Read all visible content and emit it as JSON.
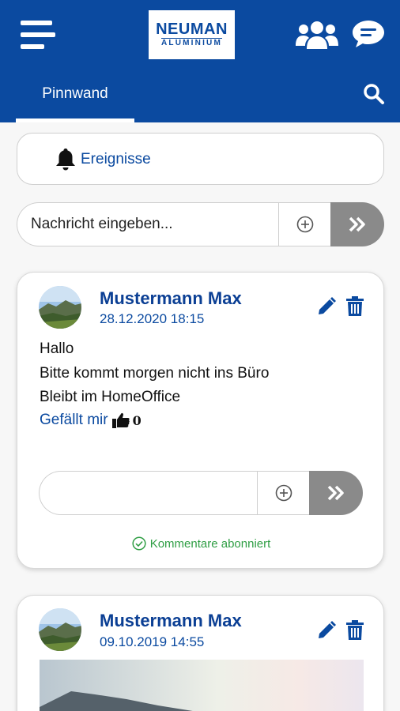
{
  "header": {
    "logo_main": "NEUMAN",
    "logo_sub": "ALUMINIUM",
    "tab_label": "Pinnwand"
  },
  "events": {
    "label": "Ereignisse"
  },
  "composer": {
    "placeholder": "Nachricht eingeben..."
  },
  "posts": [
    {
      "author": "Mustermann Max",
      "date": "28.12.2020 18:15",
      "lines": [
        "Hallo",
        "Bitte kommt morgen nicht ins Büro",
        "Bleibt im HomeOffice"
      ],
      "like_label": "Gefällt mir",
      "like_count": "0",
      "subscribed_label": "Kommentare abonniert"
    },
    {
      "author": "Mustermann Max",
      "date": "09.10.2019 14:55"
    }
  ],
  "colors": {
    "brand_blue": "#0b4aa0",
    "send_gray": "#8a8a8a",
    "subscribed_green": "#2f9e44"
  }
}
